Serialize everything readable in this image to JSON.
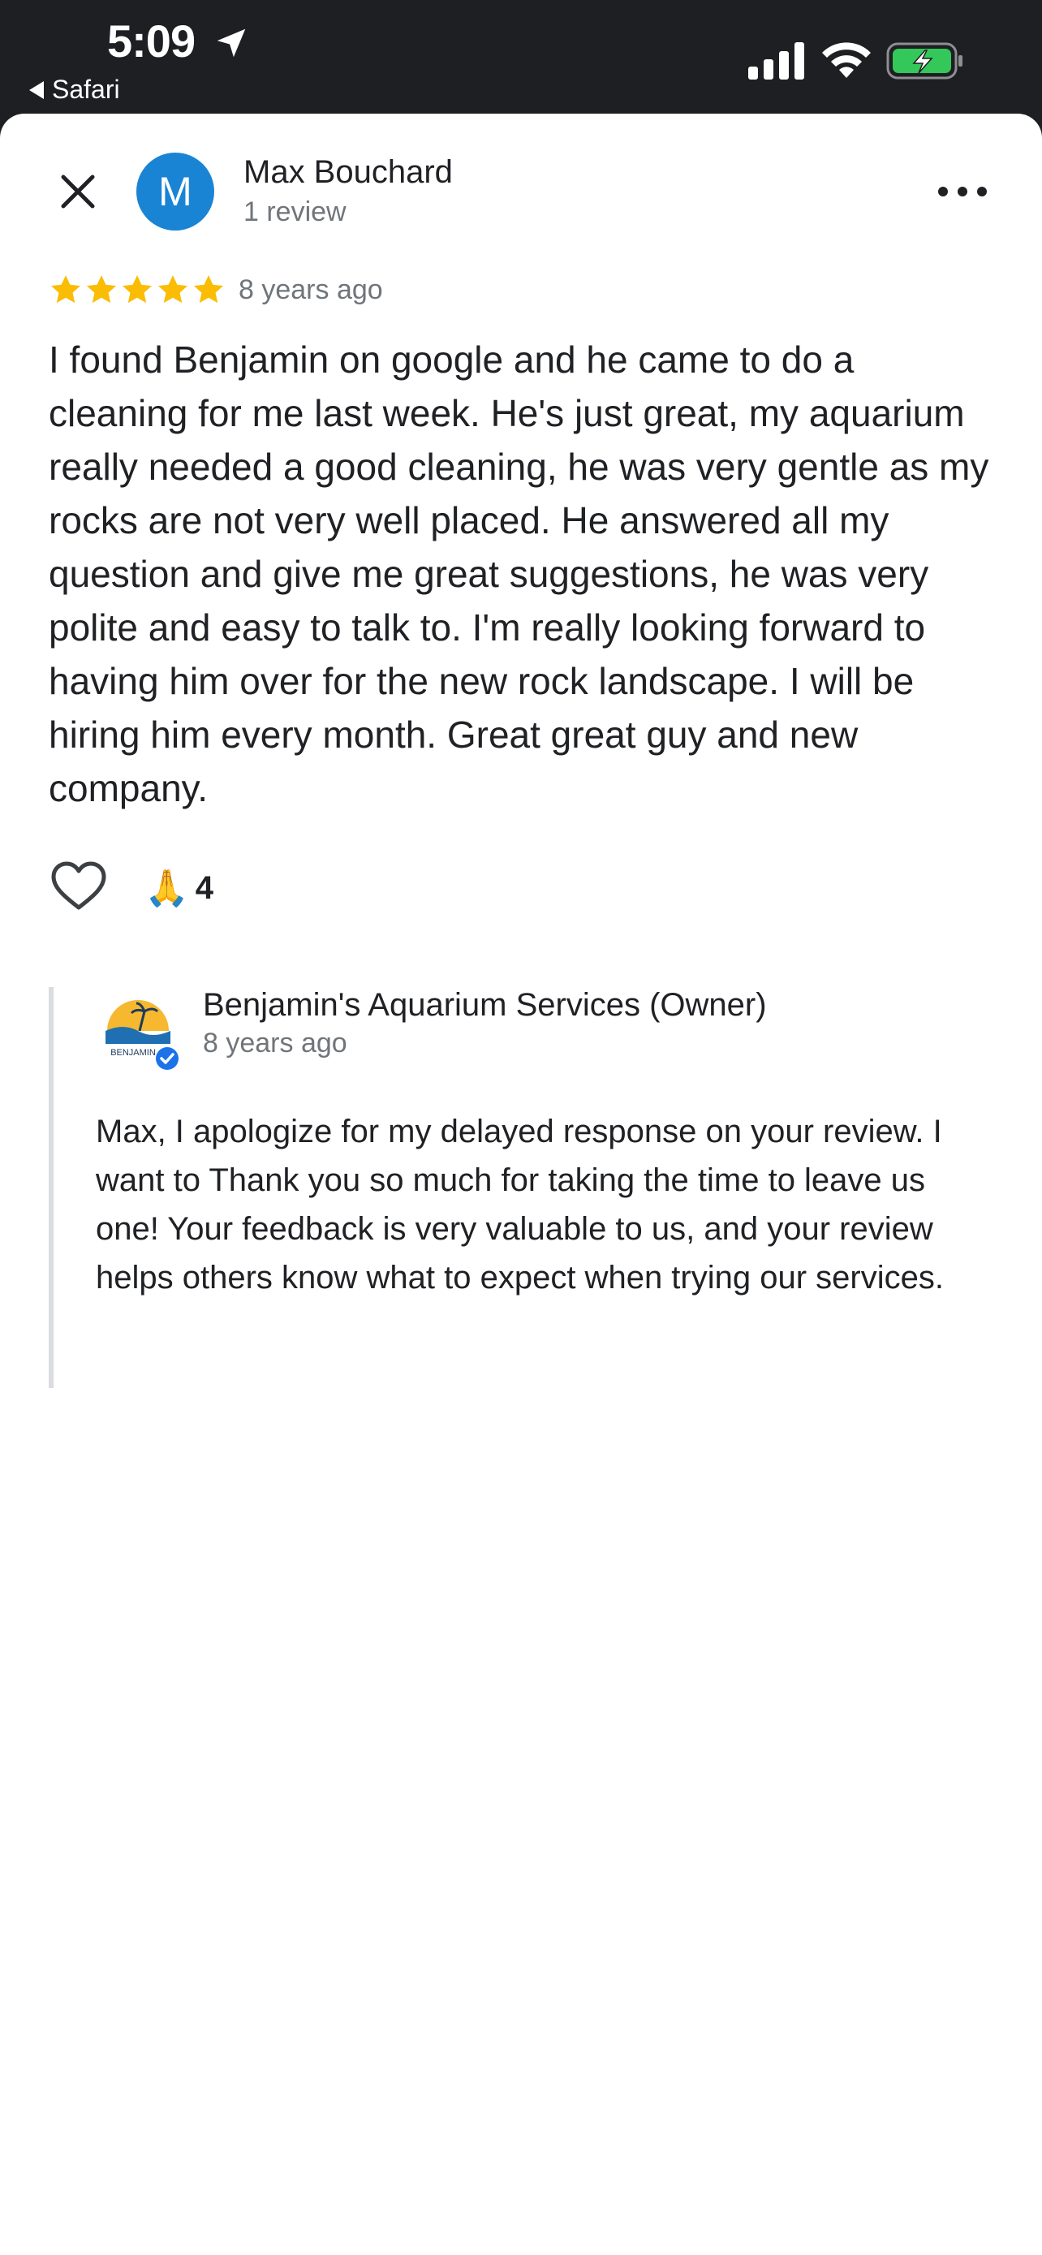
{
  "status_bar": {
    "time": "5:09",
    "back_app": "Safari"
  },
  "reviewer": {
    "avatar_initial": "M",
    "avatar_color": "#1a84d4",
    "name": "Max Bouchard",
    "review_count": "1 review"
  },
  "review": {
    "rating": 5,
    "date": "8 years ago",
    "text": "I found Benjamin on google and he came to do a cleaning for me last week. He's just great, my aquarium really needed a good cleaning, he was very gentle as my rocks are not very well placed. He answered all my question and give me great suggestions, he was very polite and easy to talk to. I'm really looking forward to having him over for the new rock landscape. I will be hiring him every month. Great great guy and new company.",
    "reaction_emoji": "🙏",
    "reaction_count": "4"
  },
  "owner_reply": {
    "name": "Benjamin's Aquarium Services (Owner)",
    "date": "8 years ago",
    "text": "Max, I apologize for my delayed response on your review. I want to Thank you so much for taking the time to leave us one! Your feedback is very valuable to us, and your review helps others know what to expect when trying our services.",
    "logo_text": "BENJAMIN"
  },
  "colors": {
    "star": "#fbbc04",
    "text_primary": "#202124",
    "text_secondary": "#70757a",
    "status_bar_bg": "#1e1f22",
    "battery_fill": "#34c759",
    "verified": "#1a73e8"
  },
  "icons": [
    "close-icon",
    "more-icon",
    "heart-icon",
    "star-icon",
    "verified-icon",
    "signal-icon",
    "wifi-icon",
    "battery-icon",
    "location-arrow-icon"
  ]
}
